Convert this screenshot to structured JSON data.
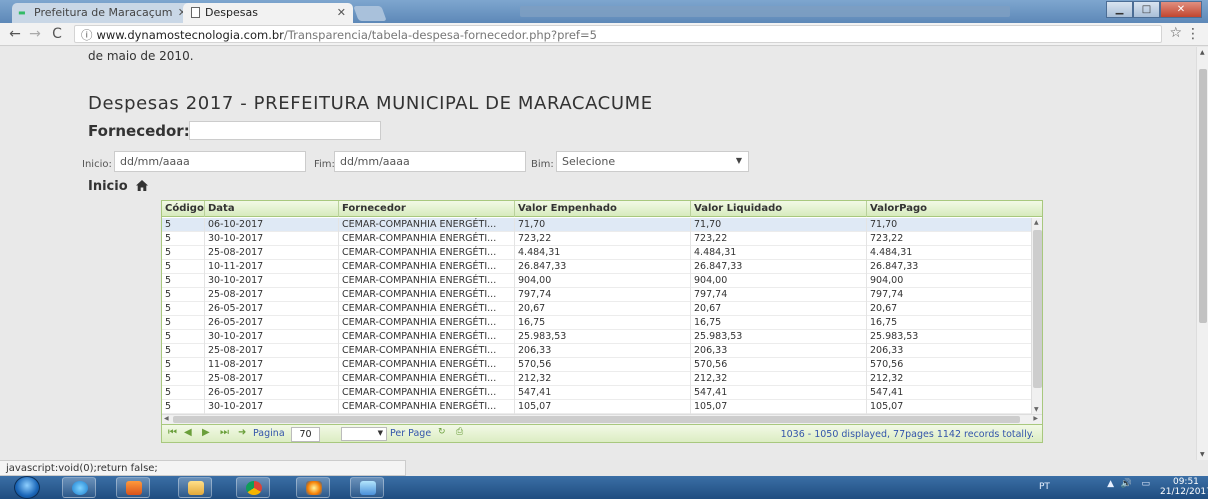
{
  "browser": {
    "tabs": [
      {
        "title": "Prefeitura de Maracaçum",
        "active": false
      },
      {
        "title": "Despesas",
        "active": true
      }
    ],
    "url_host": "www.dynamostecnologia.com.br",
    "url_path": "/Transparencia/tabela-despesa-fornecedor.php?pref=5",
    "status_text": "javascript:void(0);return false;"
  },
  "page": {
    "intro_text": "de maio de 2010.",
    "title": "Despesas 2017 - PREFEITURA MUNICIPAL DE MARACACUME",
    "supplier_label": "Fornecedor:",
    "supplier_value": "",
    "filters": {
      "start_label": "Inicio:",
      "start_placeholder": "dd/mm/aaaa",
      "end_label": "Fim:",
      "end_placeholder": "dd/mm/aaaa",
      "bim_label": "Bim:",
      "bim_selected": "Selecione"
    },
    "home_link": "Inicio"
  },
  "grid": {
    "columns": [
      "Código",
      "Data",
      "Fornecedor",
      "Valor Empenhado",
      "Valor Liquidado",
      "ValorPago"
    ],
    "rows": [
      [
        "5",
        "06-10-2017",
        "CEMAR-COMPANHIA ENERGÉTI...",
        "71,70",
        "71,70",
        "71,70"
      ],
      [
        "5",
        "30-10-2017",
        "CEMAR-COMPANHIA ENERGÉTI...",
        "723,22",
        "723,22",
        "723,22"
      ],
      [
        "5",
        "25-08-2017",
        "CEMAR-COMPANHIA ENERGÉTI...",
        "4.484,31",
        "4.484,31",
        "4.484,31"
      ],
      [
        "5",
        "10-11-2017",
        "CEMAR-COMPANHIA ENERGÉTI...",
        "26.847,33",
        "26.847,33",
        "26.847,33"
      ],
      [
        "5",
        "30-10-2017",
        "CEMAR-COMPANHIA ENERGÉTI...",
        "904,00",
        "904,00",
        "904,00"
      ],
      [
        "5",
        "25-08-2017",
        "CEMAR-COMPANHIA ENERGÉTI...",
        "797,74",
        "797,74",
        "797,74"
      ],
      [
        "5",
        "26-05-2017",
        "CEMAR-COMPANHIA ENERGÉTI...",
        "20,67",
        "20,67",
        "20,67"
      ],
      [
        "5",
        "26-05-2017",
        "CEMAR-COMPANHIA ENERGÉTI...",
        "16,75",
        "16,75",
        "16,75"
      ],
      [
        "5",
        "30-10-2017",
        "CEMAR-COMPANHIA ENERGÉTI...",
        "25.983,53",
        "25.983,53",
        "25.983,53"
      ],
      [
        "5",
        "25-08-2017",
        "CEMAR-COMPANHIA ENERGÉTI...",
        "206,33",
        "206,33",
        "206,33"
      ],
      [
        "5",
        "11-08-2017",
        "CEMAR-COMPANHIA ENERGÉTI...",
        "570,56",
        "570,56",
        "570,56"
      ],
      [
        "5",
        "25-08-2017",
        "CEMAR-COMPANHIA ENERGÉTI...",
        "212,32",
        "212,32",
        "212,32"
      ],
      [
        "5",
        "26-05-2017",
        "CEMAR-COMPANHIA ENERGÉTI...",
        "547,41",
        "547,41",
        "547,41"
      ],
      [
        "5",
        "30-10-2017",
        "CEMAR-COMPANHIA ENERGÉTI...",
        "105,07",
        "105,07",
        "105,07"
      ]
    ],
    "pager": {
      "page_label": "Pagina",
      "page_value": "70",
      "per_page_label": "Per Page",
      "summary": "1036 - 1050 displayed, 77pages 1142 records totally."
    }
  },
  "taskbar": {
    "language": "PT",
    "time": "09:51",
    "date": "21/12/2017"
  },
  "colors": {
    "grid_border": "#a8c87e",
    "grid_header": "#d7ebbd",
    "selected_row": "#dfe9f5",
    "pager_text": "#3355aa"
  }
}
